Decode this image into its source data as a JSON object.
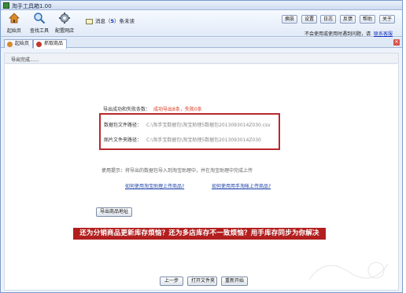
{
  "window": {
    "title": "淘手工具箱1.00"
  },
  "toolbar": {
    "tools": [
      {
        "label": "起始页"
      },
      {
        "label": "查找工具"
      },
      {
        "label": "配置网店"
      }
    ],
    "message": {
      "prefix": "消息（",
      "count": "5",
      "suffix": "）条未读"
    },
    "buttons": [
      "换肤",
      "设置",
      "日志",
      "反馈",
      "帮助",
      "关于"
    ],
    "notice": {
      "text": "不会使用或使用时遇到问题，请",
      "link": "联系客服"
    }
  },
  "tabs": [
    {
      "label": "起始页",
      "active": false
    },
    {
      "label": "抓取商品",
      "active": true
    }
  ],
  "section": {
    "status": "导出完成......"
  },
  "result": {
    "summary_label": "导出成功和失败条数：",
    "summary_value": "成功导出8条，失败0条",
    "package_label": "数据包文件路径：",
    "package_path": "C:\\淘手宝数据包\\淘宝助理5数据包2013093014Z030.csv",
    "image_label": "图片文件夹路径：",
    "image_path": "C:\\淘手宝数据包\\淘宝助理5数据包2013093014Z030"
  },
  "hint": {
    "label": "使用提示：",
    "text": "将导出的数据包导入到淘宝助理中，并在淘宝助理中完成上传"
  },
  "links": {
    "help_assistant": "如何使用淘宝助理上传商品?",
    "help_phone": "如何使用用手淘帐上传商品?"
  },
  "actions": {
    "export_address": "导出商品地址",
    "prev": "上一步",
    "open_folder": "打开文件夹",
    "restart": "重新开始"
  },
  "banner": {
    "text": "还为分销商品更新库存烦恼？还为多店库存不一致烦恼？用手库存同步为你解决"
  },
  "colors": {
    "banner_bg": "#b21f1f",
    "highlight_box": "#b8282c",
    "link": "#1a3fa8",
    "success": "#d9381e"
  }
}
